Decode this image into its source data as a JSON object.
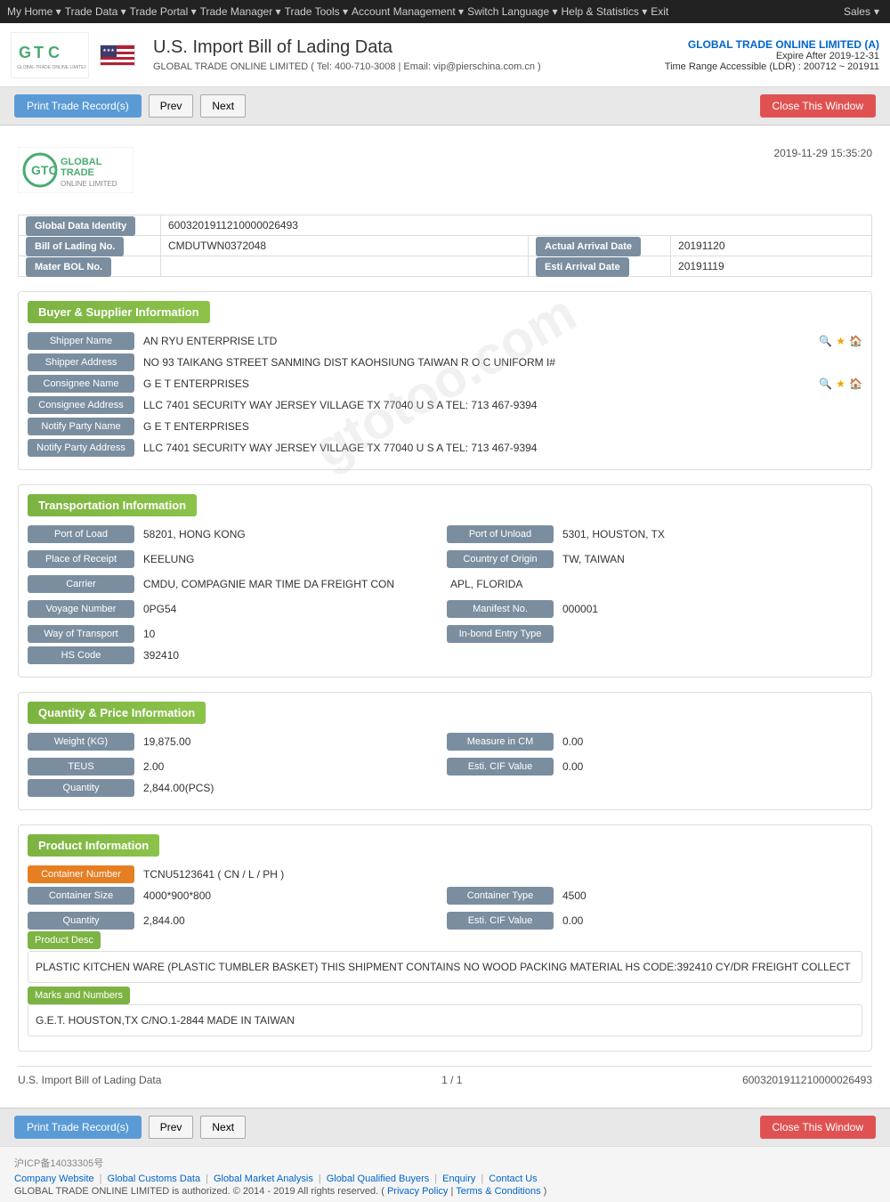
{
  "topNav": {
    "items": [
      {
        "label": "My Home",
        "id": "my-home"
      },
      {
        "label": "Trade Data",
        "id": "trade-data"
      },
      {
        "label": "Trade Portal",
        "id": "trade-portal"
      },
      {
        "label": "Trade Manager",
        "id": "trade-manager"
      },
      {
        "label": "Trade Tools",
        "id": "trade-tools"
      },
      {
        "label": "Account Management",
        "id": "account-management"
      },
      {
        "label": "Switch Language",
        "id": "switch-language"
      },
      {
        "label": "Help & Statistics",
        "id": "help-statistics"
      },
      {
        "label": "Exit",
        "id": "exit"
      }
    ],
    "sales": "Sales"
  },
  "header": {
    "logoText": "GTC",
    "logoSubtitle": "GLOBAL TRADE ONLINE LIMITED",
    "flagAlt": "US Flag",
    "title": "U.S. Import Bill of Lading Data",
    "companyLine": "GLOBAL TRADE ONLINE LIMITED ( Tel: 400-710-3008 | Email: vip@pierschina.com.cn )",
    "companyName": "GLOBAL TRADE ONLINE LIMITED (A)",
    "expire": "Expire After 2019-12-31",
    "ldr": "Time Range Accessible (LDR) : 200712 ~ 201911"
  },
  "toolbar": {
    "printLabel": "Print Trade Record(s)",
    "prevLabel": "Prev",
    "nextLabel": "Next",
    "closeLabel": "Close This Window"
  },
  "document": {
    "timestamp": "2019-11-29 15:35:20",
    "globalDataIdentityLabel": "Global Data Identity",
    "globalDataIdentityValue": "6003201911210000026493",
    "billOfLadingLabel": "Bill of Lading No.",
    "billOfLadingValue": "CMDUTWN0372048",
    "actualArrivalDateLabel": "Actual Arrival Date",
    "actualArrivalDateValue": "20191120",
    "masterBolLabel": "Mater BOL No.",
    "masterBolValue": "",
    "estiArrivalDateLabel": "Esti Arrival Date",
    "estiArrivalDateValue": "20191119"
  },
  "buyerSupplier": {
    "sectionTitle": "Buyer & Supplier Information",
    "shipperNameLabel": "Shipper Name",
    "shipperNameValue": "AN RYU ENTERPRISE LTD",
    "shipperAddressLabel": "Shipper Address",
    "shipperAddressValue": "NO 93 TAIKANG STREET SANMING DIST KAOHSIUNG TAIWAN R O C UNIFORM I#",
    "consigneeNameLabel": "Consignee Name",
    "consigneeNameValue": "G E T ENTERPRISES",
    "consigneeAddressLabel": "Consignee Address",
    "consigneeAddressValue": "LLC 7401 SECURITY WAY JERSEY VILLAGE TX 77040 U S A TEL: 713 467-9394",
    "notifyPartyNameLabel": "Notify Party Name",
    "notifyPartyNameValue": "G E T ENTERPRISES",
    "notifyPartyAddressLabel": "Notify Party Address",
    "notifyPartyAddressValue": "LLC 7401 SECURITY WAY JERSEY VILLAGE TX 77040 U S A TEL: 713 467-9394"
  },
  "transportation": {
    "sectionTitle": "Transportation Information",
    "portOfLoadLabel": "Port of Load",
    "portOfLoadValue": "58201, HONG KONG",
    "portOfUnloadLabel": "Port of Unload",
    "portOfUnloadValue": "5301, HOUSTON, TX",
    "placeOfReceiptLabel": "Place of Receipt",
    "placeOfReceiptValue": "KEELUNG",
    "countryOfOriginLabel": "Country of Origin",
    "countryOfOriginValue": "TW, TAIWAN",
    "carrierLabel": "Carrier",
    "carrierValue": "CMDU, COMPAGNIE MAR TIME DA FREIGHT CON",
    "carrierValueRight": "APL, FLORIDA",
    "voyageNumberLabel": "Voyage Number",
    "voyageNumberValue": "0PG54",
    "manifestNoLabel": "Manifest No.",
    "manifestNoValue": "000001",
    "wayOfTransportLabel": "Way of Transport",
    "wayOfTransportValue": "10",
    "inbondEntryTypeLabel": "In-bond Entry Type",
    "inbondEntryTypeValue": "",
    "hsCodeLabel": "HS Code",
    "hsCodeValue": "392410"
  },
  "quantityPrice": {
    "sectionTitle": "Quantity & Price Information",
    "weightLabel": "Weight (KG)",
    "weightValue": "19,875.00",
    "measureLabel": "Measure in CM",
    "measureValue": "0.00",
    "teusLabel": "TEUS",
    "teusValue": "2.00",
    "estiCIFLabel": "Esti. CIF Value",
    "estiCIFValue": "0.00",
    "quantityLabel": "Quantity",
    "quantityValue": "2,844.00(PCS)"
  },
  "productInfo": {
    "sectionTitle": "Product Information",
    "containerNumberLabel": "Container Number",
    "containerNumberValue": "TCNU5123641 ( CN / L / PH )",
    "containerSizeLabel": "Container Size",
    "containerSizeValue": "4000*900*800",
    "containerTypeLabel": "Container Type",
    "containerTypeValue": "4500",
    "quantityLabel": "Quantity",
    "quantityValue": "2,844.00",
    "estiCIFLabel": "Esti. CIF Value",
    "estiCIFValue": "0.00",
    "productDescLabel": "Product Desc",
    "productDescValue": "PLASTIC KITCHEN WARE (PLASTIC TUMBLER BASKET) THIS SHIPMENT CONTAINS NO WOOD PACKING MATERIAL HS CODE:392410 CY/DR FREIGHT COLLECT",
    "marksNumbersLabel": "Marks and Numbers",
    "marksNumbersValue": "G.E.T. HOUSTON,TX C/NO.1-2844 MADE IN TAIWAN"
  },
  "docFooter": {
    "docType": "U.S. Import Bill of Lading Data",
    "pageInfo": "1 / 1",
    "docId": "6003201911210000026493"
  },
  "footer": {
    "icp": "沪ICP备14033305号",
    "links": [
      {
        "label": "Company Website",
        "id": "company-website"
      },
      {
        "label": "Global Customs Data",
        "id": "global-customs-data"
      },
      {
        "label": "Global Market Analysis",
        "id": "global-market-analysis"
      },
      {
        "label": "Global Qualified Buyers",
        "id": "global-qualified-buyers"
      },
      {
        "label": "Enquiry",
        "id": "enquiry"
      },
      {
        "label": "Contact Us",
        "id": "contact-us"
      }
    ],
    "copyright": "GLOBAL TRADE ONLINE LIMITED is authorized. © 2014 - 2019 All rights reserved.  (",
    "privacyPolicy": "Privacy Policy",
    "terms": "Terms & Conditions",
    "copyrightEnd": " )"
  },
  "watermark": "gtotoo.com"
}
